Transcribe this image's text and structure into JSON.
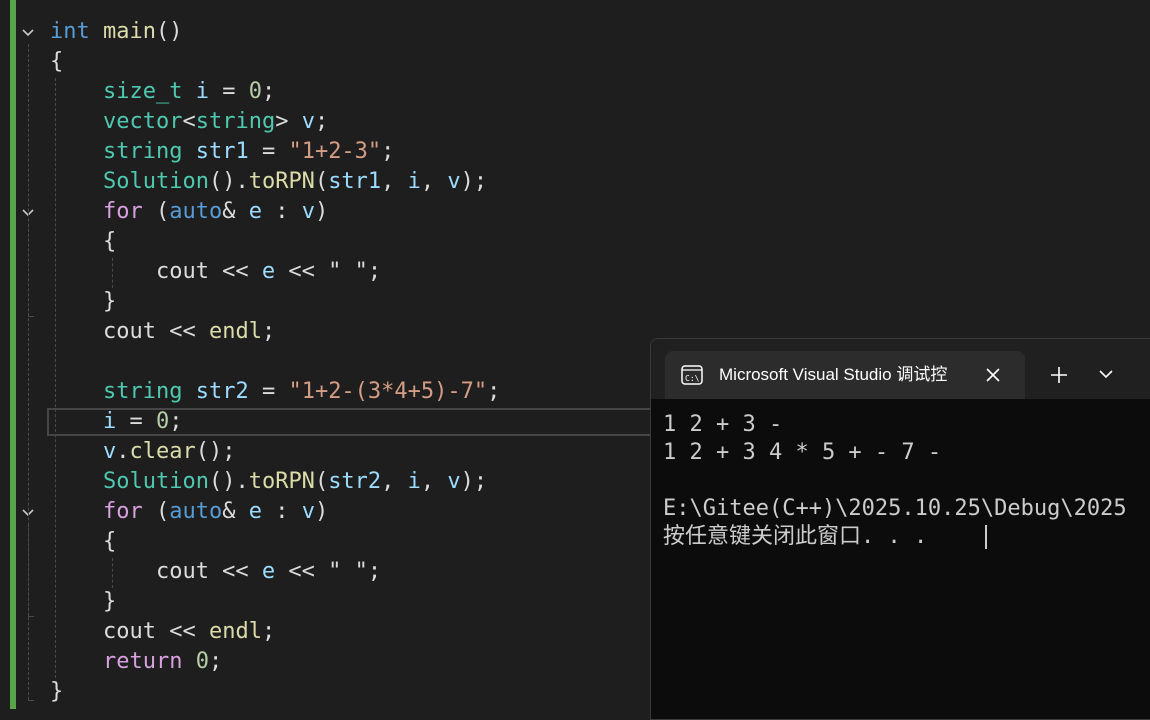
{
  "editor": {
    "lines": [
      [
        {
          "t": "int",
          "c": "kw"
        },
        {
          "t": " ",
          "c": "plain"
        },
        {
          "t": "main",
          "c": "fn"
        },
        {
          "t": "()",
          "c": "plain"
        }
      ],
      [
        {
          "t": "{",
          "c": "plain"
        }
      ],
      [
        {
          "t": "    ",
          "c": "plain"
        },
        {
          "t": "size_t",
          "c": "type"
        },
        {
          "t": " ",
          "c": "plain"
        },
        {
          "t": "i",
          "c": "var"
        },
        {
          "t": " = ",
          "c": "plain"
        },
        {
          "t": "0",
          "c": "num"
        },
        {
          "t": ";",
          "c": "plain"
        }
      ],
      [
        {
          "t": "    ",
          "c": "plain"
        },
        {
          "t": "vector",
          "c": "type"
        },
        {
          "t": "<",
          "c": "plain"
        },
        {
          "t": "string",
          "c": "type"
        },
        {
          "t": "> ",
          "c": "plain"
        },
        {
          "t": "v",
          "c": "var"
        },
        {
          "t": ";",
          "c": "plain"
        }
      ],
      [
        {
          "t": "    ",
          "c": "plain"
        },
        {
          "t": "string",
          "c": "type"
        },
        {
          "t": " ",
          "c": "plain"
        },
        {
          "t": "str1",
          "c": "var"
        },
        {
          "t": " = ",
          "c": "plain"
        },
        {
          "t": "\"1+2-3\"",
          "c": "str"
        },
        {
          "t": ";",
          "c": "plain"
        }
      ],
      [
        {
          "t": "    ",
          "c": "plain"
        },
        {
          "t": "Solution",
          "c": "type"
        },
        {
          "t": "().",
          "c": "plain"
        },
        {
          "t": "toRPN",
          "c": "fn"
        },
        {
          "t": "(",
          "c": "plain"
        },
        {
          "t": "str1",
          "c": "var"
        },
        {
          "t": ", ",
          "c": "plain"
        },
        {
          "t": "i",
          "c": "var"
        },
        {
          "t": ", ",
          "c": "plain"
        },
        {
          "t": "v",
          "c": "var"
        },
        {
          "t": ");",
          "c": "plain"
        }
      ],
      [
        {
          "t": "    ",
          "c": "plain"
        },
        {
          "t": "for",
          "c": "ctl"
        },
        {
          "t": " (",
          "c": "plain"
        },
        {
          "t": "auto",
          "c": "kw"
        },
        {
          "t": "& ",
          "c": "plain"
        },
        {
          "t": "e",
          "c": "var"
        },
        {
          "t": " : ",
          "c": "plain"
        },
        {
          "t": "v",
          "c": "var"
        },
        {
          "t": ")",
          "c": "plain"
        }
      ],
      [
        {
          "t": "    {",
          "c": "plain"
        }
      ],
      [
        {
          "t": "        cout << ",
          "c": "plain"
        },
        {
          "t": "e",
          "c": "var"
        },
        {
          "t": " << ",
          "c": "plain"
        },
        {
          "t": "\" \"",
          "c": "plain"
        },
        {
          "t": ";",
          "c": "plain"
        }
      ],
      [
        {
          "t": "    }",
          "c": "plain"
        }
      ],
      [
        {
          "t": "    cout << ",
          "c": "plain"
        },
        {
          "t": "endl",
          "c": "fn"
        },
        {
          "t": ";",
          "c": "plain"
        }
      ],
      [],
      [
        {
          "t": "    ",
          "c": "plain"
        },
        {
          "t": "string",
          "c": "type"
        },
        {
          "t": " ",
          "c": "plain"
        },
        {
          "t": "str2",
          "c": "var"
        },
        {
          "t": " = ",
          "c": "plain"
        },
        {
          "t": "\"1+2-(3*4+5)-7\"",
          "c": "str"
        },
        {
          "t": ";",
          "c": "plain"
        }
      ],
      [
        {
          "t": "    ",
          "c": "plain"
        },
        {
          "t": "i",
          "c": "var"
        },
        {
          "t": " = ",
          "c": "plain"
        },
        {
          "t": "0",
          "c": "num"
        },
        {
          "t": ";",
          "c": "plain"
        }
      ],
      [
        {
          "t": "    ",
          "c": "plain"
        },
        {
          "t": "v",
          "c": "var"
        },
        {
          "t": ".",
          "c": "plain"
        },
        {
          "t": "clear",
          "c": "fn"
        },
        {
          "t": "();",
          "c": "plain"
        }
      ],
      [
        {
          "t": "    ",
          "c": "plain"
        },
        {
          "t": "Solution",
          "c": "type"
        },
        {
          "t": "().",
          "c": "plain"
        },
        {
          "t": "toRPN",
          "c": "fn"
        },
        {
          "t": "(",
          "c": "plain"
        },
        {
          "t": "str2",
          "c": "var"
        },
        {
          "t": ", ",
          "c": "plain"
        },
        {
          "t": "i",
          "c": "var"
        },
        {
          "t": ", ",
          "c": "plain"
        },
        {
          "t": "v",
          "c": "var"
        },
        {
          "t": ");",
          "c": "plain"
        }
      ],
      [
        {
          "t": "    ",
          "c": "plain"
        },
        {
          "t": "for",
          "c": "ctl"
        },
        {
          "t": " (",
          "c": "plain"
        },
        {
          "t": "auto",
          "c": "kw"
        },
        {
          "t": "& ",
          "c": "plain"
        },
        {
          "t": "e",
          "c": "var"
        },
        {
          "t": " : ",
          "c": "plain"
        },
        {
          "t": "v",
          "c": "var"
        },
        {
          "t": ")",
          "c": "plain"
        }
      ],
      [
        {
          "t": "    {",
          "c": "plain"
        }
      ],
      [
        {
          "t": "        cout << ",
          "c": "plain"
        },
        {
          "t": "e",
          "c": "var"
        },
        {
          "t": " << ",
          "c": "plain"
        },
        {
          "t": "\" \"",
          "c": "plain"
        },
        {
          "t": ";",
          "c": "plain"
        }
      ],
      [
        {
          "t": "    }",
          "c": "plain"
        }
      ],
      [
        {
          "t": "    cout << ",
          "c": "plain"
        },
        {
          "t": "endl",
          "c": "fn"
        },
        {
          "t": ";",
          "c": "plain"
        }
      ],
      [
        {
          "t": "    ",
          "c": "plain"
        },
        {
          "t": "return",
          "c": "ctl"
        },
        {
          "t": " ",
          "c": "plain"
        },
        {
          "t": "0",
          "c": "num"
        },
        {
          "t": ";",
          "c": "plain"
        }
      ],
      [
        {
          "t": "}",
          "c": "plain"
        }
      ]
    ]
  },
  "terminal": {
    "tab_title": "Microsoft Visual Studio 调试控",
    "lines": [
      "1 2 + 3 -",
      "1 2 + 3 4 * 5 + - 7 -",
      "",
      "E:\\Gitee(C++)\\2025.10.25\\Debug\\2025",
      "按任意键关闭此窗口. . ."
    ]
  },
  "colors": {
    "background": "#1e1e1e",
    "change_bar": "#57a64a",
    "keyword": "#569cd6",
    "control": "#d8a0df",
    "type": "#4ec9b0",
    "function": "#dcdcaa",
    "variable": "#9cdcfe",
    "string": "#d69d85",
    "number": "#b5cea8"
  }
}
